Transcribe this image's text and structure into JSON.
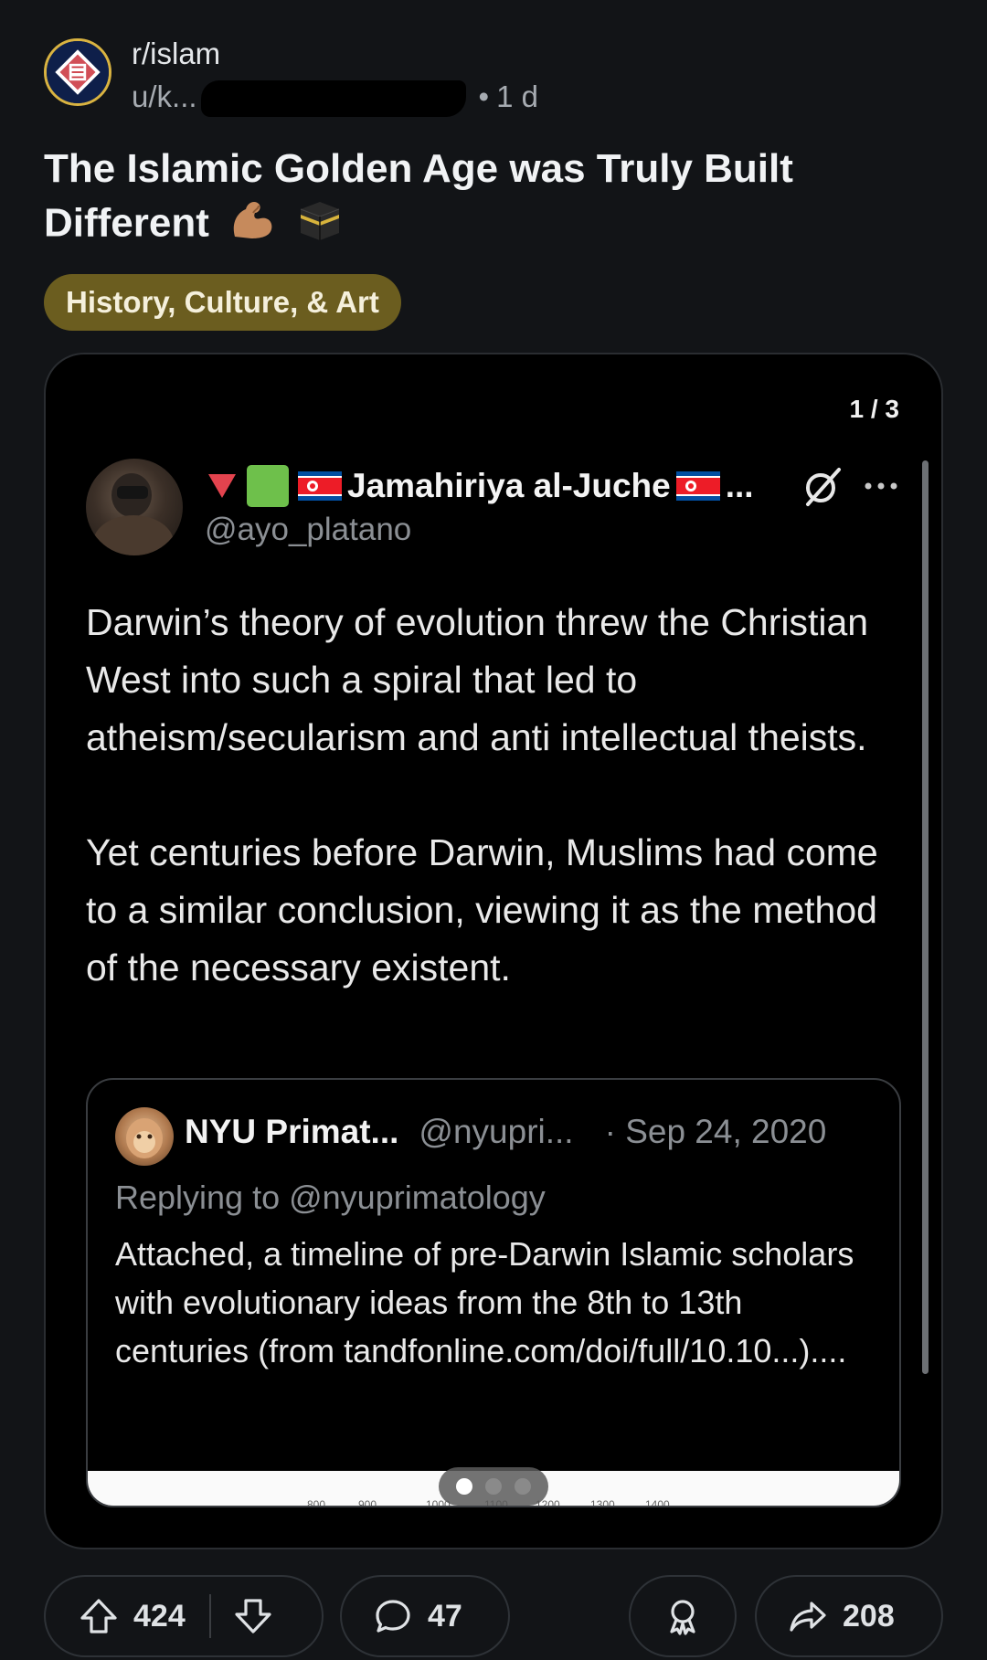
{
  "post": {
    "subreddit": "r/islam",
    "user_prefix": "u/k...",
    "time": "1 d",
    "title": "The Islamic Golden Age was Truly Built Different",
    "title_emojis": [
      "flexed-biceps-emoji",
      "kaaba-emoji"
    ],
    "flair": "History, Culture, & Art"
  },
  "media": {
    "counter": "1 / 3",
    "page_index": 1,
    "page_count": 3,
    "tweet": {
      "display_name": "Jamahiriya al-Juche",
      "ellipsis": "...",
      "handle": "@ayo_platano",
      "name_decorations": [
        "red-down-triangle-icon",
        "green-square-icon",
        "north-korea-flag-icon"
      ],
      "body": [
        "Darwin’s theory of evolution threw the Christian West into such a spiral that led to atheism/secularism and anti intellectual theists.",
        "Yet centuries before Darwin, Muslims had come to a similar conclusion, viewing it as the method of the necessary existent."
      ],
      "quote": {
        "name": "NYU Primat...",
        "handle": "@nyupri...",
        "date": "· Sep 24, 2020",
        "reply_to": "Replying to @nyuprimatology",
        "body": "Attached, a timeline of pre-Darwin Islamic scholars with evolutionary ideas from the 8th to 13th centuries (from tandfonline.com/doi/full/10.10...)....",
        "timeline_ticks": [
          "800",
          "900",
          "1000",
          "1100",
          "1200",
          "1300",
          "1400"
        ]
      }
    }
  },
  "actions": {
    "upvotes": "424",
    "comments": "47",
    "shares": "208"
  },
  "colors": {
    "background": "#121417",
    "flair_bg": "#6b5d1f",
    "accent_red": "#e3434e",
    "accent_green": "#6ec04b"
  }
}
